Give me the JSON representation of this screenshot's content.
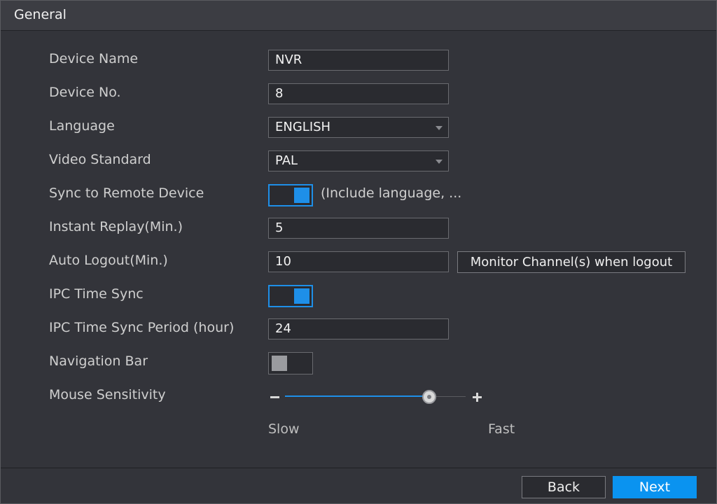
{
  "window": {
    "title": "General"
  },
  "form": {
    "device_name": {
      "label": "Device Name",
      "value": "NVR"
    },
    "device_no": {
      "label": "Device No.",
      "value": "8"
    },
    "language": {
      "label": "Language",
      "value": "ENGLISH"
    },
    "video_standard": {
      "label": "Video Standard",
      "value": "PAL"
    },
    "sync_remote": {
      "label": "Sync to Remote Device",
      "enabled": true,
      "hint": "(Include language, ..."
    },
    "instant_replay": {
      "label": "Instant Replay(Min.)",
      "value": "5"
    },
    "auto_logout": {
      "label": "Auto Logout(Min.)",
      "value": "10",
      "button_label": "Monitor Channel(s) when logout"
    },
    "ipc_time_sync": {
      "label": "IPC Time Sync",
      "enabled": true
    },
    "ipc_sync_period": {
      "label": "IPC Time Sync Period (hour)",
      "value": "24"
    },
    "navigation_bar": {
      "label": "Navigation Bar",
      "enabled": false
    },
    "mouse_sensitivity": {
      "label": "Mouse Sensitivity",
      "level": 0.8,
      "slow_label": "Slow",
      "fast_label": "Fast"
    }
  },
  "footer": {
    "back_label": "Back",
    "next_label": "Next"
  },
  "colors": {
    "accent": "#0a93f0",
    "background": "#33343a"
  }
}
